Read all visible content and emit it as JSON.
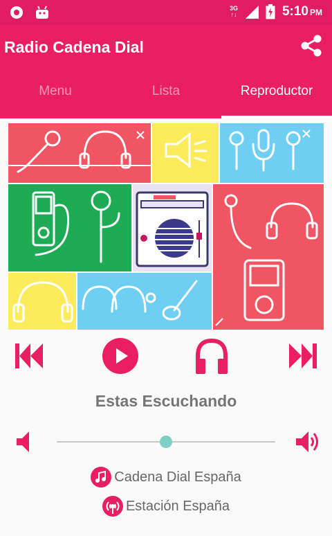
{
  "status_bar": {
    "network": "3G",
    "time": "5:10",
    "ampm": "PM",
    "icons": [
      "record-icon",
      "android-debug-icon",
      "network-3g-icon",
      "signal-icon",
      "battery-charging-icon"
    ]
  },
  "app_bar": {
    "title": "Radio Cadena Dial",
    "share_icon": "share-icon"
  },
  "tabs": [
    {
      "label": "Menu",
      "active": false
    },
    {
      "label": "Lista",
      "active": false
    },
    {
      "label": "Reproductor",
      "active": true
    }
  ],
  "player": {
    "now_playing_label": "Estas Escuchando",
    "volume_level": 0.5,
    "station_name": "Cadena Dial España",
    "station_country": "Estación España",
    "controls": [
      "skip-previous-icon",
      "play-icon",
      "headphones-icon",
      "skip-next-icon"
    ]
  },
  "colors": {
    "primary": "#e91e63",
    "status_bar": "#e01c63",
    "slider_thumb": "#7fcfc7",
    "text_secondary": "#757575"
  }
}
